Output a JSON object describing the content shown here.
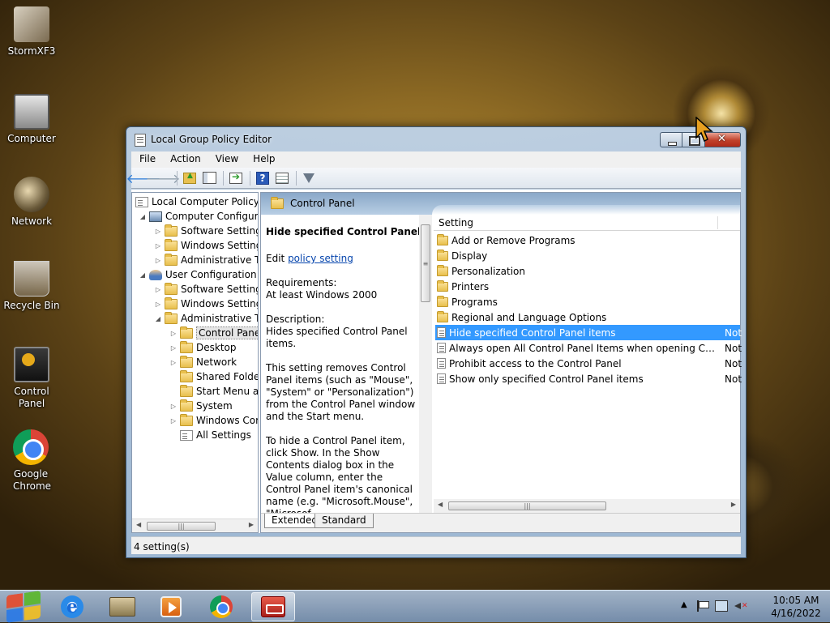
{
  "desktop": {
    "icons": [
      {
        "label": "StormXF3",
        "icon": "stormxf3-icon"
      },
      {
        "label": "Computer",
        "icon": "computer-icon"
      },
      {
        "label": "Network",
        "icon": "network-icon"
      },
      {
        "label": "Recycle Bin",
        "icon": "recycle-bin-icon"
      },
      {
        "label": "Control Panel",
        "icon": "control-panel-icon"
      },
      {
        "label": "Google Chrome",
        "icon": "chrome-icon"
      }
    ]
  },
  "window": {
    "title": "Local Group Policy Editor",
    "menu": [
      "File",
      "Action",
      "View",
      "Help"
    ],
    "tree": [
      {
        "label": "Local Computer Policy",
        "icon": "policy-icon",
        "expander": ""
      },
      {
        "label": "Computer Configura",
        "icon": "computer-icon",
        "expander": "◢"
      },
      {
        "label": "Software Settings",
        "icon": "folder-icon",
        "expander": "▷"
      },
      {
        "label": "Windows Setting",
        "icon": "folder-icon",
        "expander": "▷"
      },
      {
        "label": "Administrative Te",
        "icon": "folder-icon",
        "expander": "▷"
      },
      {
        "label": "User Configuration",
        "icon": "user-icon",
        "expander": "◢"
      },
      {
        "label": "Software Settings",
        "icon": "folder-icon",
        "expander": "▷"
      },
      {
        "label": "Windows Setting",
        "icon": "folder-icon",
        "expander": "▷"
      },
      {
        "label": "Administrative Te",
        "icon": "folder-icon",
        "expander": "◢"
      },
      {
        "label": "Control Panel",
        "icon": "folder-icon",
        "expander": "▷"
      },
      {
        "label": "Desktop",
        "icon": "folder-icon",
        "expander": "▷"
      },
      {
        "label": "Network",
        "icon": "folder-icon",
        "expander": "▷"
      },
      {
        "label": "Shared Folder",
        "icon": "folder-icon",
        "expander": ""
      },
      {
        "label": "Start Menu ar",
        "icon": "folder-icon",
        "expander": ""
      },
      {
        "label": "System",
        "icon": "folder-icon",
        "expander": "▷"
      },
      {
        "label": "Windows Cor",
        "icon": "folder-icon",
        "expander": "▷"
      },
      {
        "label": "All Settings",
        "icon": "policy-icon",
        "expander": ""
      }
    ],
    "header_title": "Control Panel",
    "extended": {
      "policy_title": "Hide specified Control Panel items",
      "edit_prefix": "Edit ",
      "edit_link": "policy setting ",
      "requirements_label": "Requirements:",
      "requirements_value": "At least Windows 2000",
      "description_label": "Description:",
      "description_value": "Hides specified Control Panel items.",
      "para1": "This setting removes Control Panel items (such as \"Mouse\", \"System\" or \"Personalization\") from the Control Panel window and the Start menu.",
      "para2": "To hide a Control Panel item, click Show. In the Show Contents dialog box in the Value column, enter the Control Panel item's canonical name (e.g. \"Microsoft.Mouse\", \"Microsof"
    },
    "list": {
      "column_setting": "Setting",
      "rows": [
        {
          "name": "Add or Remove Programs",
          "type": "folder",
          "state": ""
        },
        {
          "name": "Display",
          "type": "folder",
          "state": ""
        },
        {
          "name": "Personalization",
          "type": "folder",
          "state": ""
        },
        {
          "name": "Printers",
          "type": "folder",
          "state": ""
        },
        {
          "name": "Programs",
          "type": "folder",
          "state": ""
        },
        {
          "name": "Regional and Language Options",
          "type": "folder",
          "state": ""
        },
        {
          "name": "Hide specified Control Panel items",
          "type": "policy",
          "state": "Not"
        },
        {
          "name": "Always open All Control Panel Items when opening Control ...",
          "type": "policy",
          "state": "Not"
        },
        {
          "name": "Prohibit access to the Control Panel",
          "type": "policy",
          "state": "Not"
        },
        {
          "name": "Show only specified Control Panel items",
          "type": "policy",
          "state": "Not"
        }
      ],
      "selected_index": 6
    },
    "tabs": [
      "Extended",
      "Standard"
    ],
    "status": "4 setting(s)"
  },
  "taskbar": {
    "items": [
      "internet-explorer-icon",
      "windows-explorer-icon",
      "media-player-icon",
      "chrome-icon",
      "group-policy-editor-icon"
    ],
    "time": "10:05 AM",
    "date": "4/16/2022",
    "tray_arrow": "▲"
  }
}
